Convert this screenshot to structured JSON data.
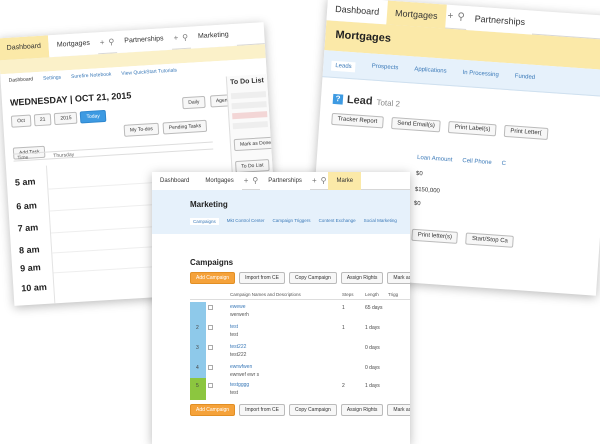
{
  "c1": {
    "tabs": [
      "Dashboard",
      "Mortgages",
      "Partnerships",
      "Marketing"
    ],
    "subtabs": [
      "Dashboard",
      "Settings",
      "Surefire Notebook",
      "View QuickStart Tutorials"
    ],
    "date": "WEDNESDAY | OCT 21, 2015",
    "daily": "Daily",
    "agenda": "Agenda",
    "month": "Oct",
    "day": "21",
    "year": "2015",
    "today": "Today",
    "my_todos": "My To-dos",
    "pending": "Pending Tasks",
    "add_task": "Add Task",
    "col_time": "Time",
    "col_day": "Thursday",
    "hours": [
      "5 am",
      "6 am",
      "7 am",
      "8 am",
      "9 am",
      "10 am"
    ],
    "todo_title": "To Do List",
    "mark_done": "Mark as Done",
    "todo_list": "To Do List"
  },
  "c2": {
    "tabs": [
      "Dashboard",
      "Mortgages",
      "Partnerships"
    ],
    "title": "Mortgages",
    "subtabs": [
      "Leads",
      "Prospects",
      "Applications",
      "In Processing",
      "Funded"
    ],
    "lead": "Lead",
    "total": "Total 2",
    "actions": [
      "Tracker Report",
      "Send Email(s)",
      "Print Label(s)",
      "Print Letter("
    ],
    "columns": [
      "Loan Amount",
      "Cell Phone",
      "C"
    ],
    "values": [
      "$0",
      "$150,000",
      "$0"
    ],
    "bottom": [
      "Print letter(s)",
      "Start/Stop Ca"
    ]
  },
  "c3": {
    "tabs": [
      "Dashboard",
      "Mortgages",
      "Partnerships",
      "Marke"
    ],
    "title": "Marketing",
    "subtabs": [
      "Campaigns",
      "Mkt Control Center",
      "Campaign Triggers",
      "Content Exchange",
      "Social Marketing"
    ],
    "heading": "Campaigns",
    "actions": [
      "Add Campaign",
      "Import from CE",
      "Copy Campaign",
      "Assign Rights",
      "Mark as Hidd"
    ],
    "columns": [
      "Campaign Names and Descriptions",
      "Steps",
      "Length",
      "Trigg"
    ],
    "rows": [
      {
        "num": "",
        "name": "ewewe",
        "desc": "werwerh",
        "steps": "1",
        "length": "65 days"
      },
      {
        "num": "2",
        "name": "test",
        "desc": "test",
        "steps": "1",
        "length": "1 days"
      },
      {
        "num": "3",
        "name": "test222",
        "desc": "test222",
        "steps": "",
        "length": "0 days"
      },
      {
        "num": "4",
        "name": "ewrwfwen",
        "desc": "ewrwef ewr s",
        "steps": "",
        "length": "0 days"
      },
      {
        "num": "5",
        "name": "testgggg",
        "desc": "test",
        "steps": "2",
        "length": "1 days"
      }
    ]
  }
}
